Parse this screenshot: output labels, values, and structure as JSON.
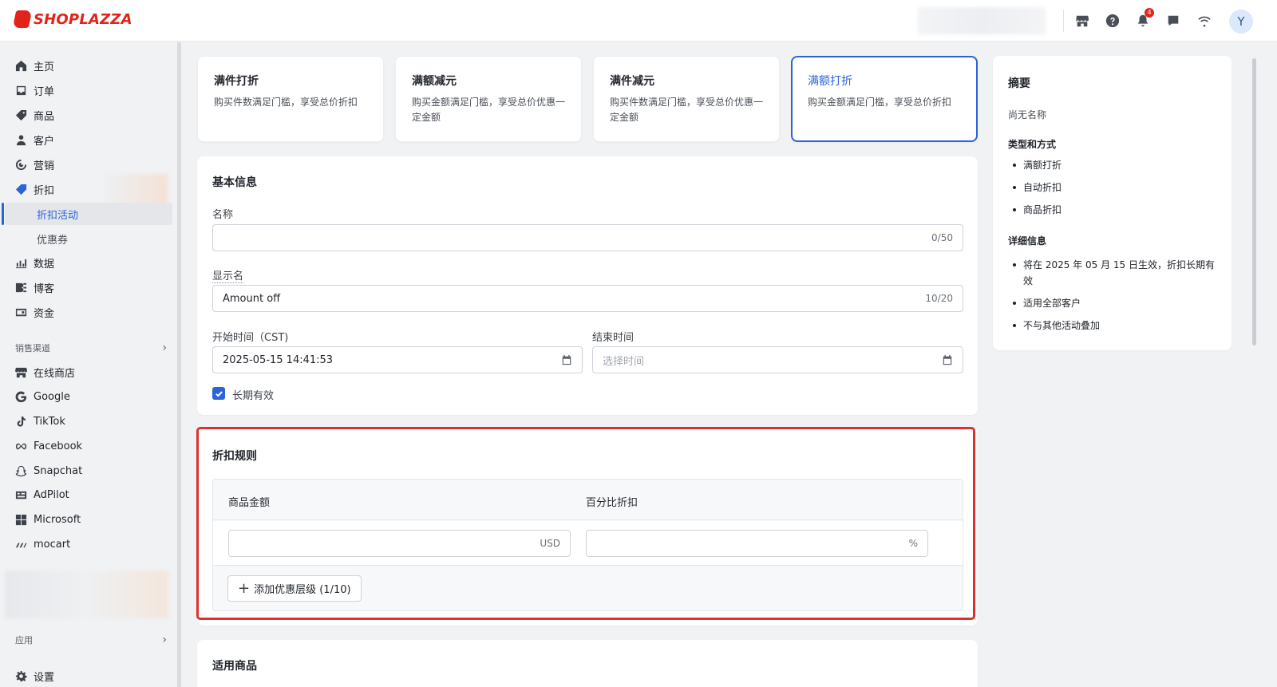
{
  "brand": {
    "name": "SHOPLAZZA",
    "color": "#e2231a"
  },
  "accent_color": "#2b63d9",
  "header": {
    "notifications_count": "4",
    "avatar_initial": "Y",
    "icons": [
      "store-icon",
      "help-icon",
      "bell-icon",
      "chat-icon",
      "wifi-icon"
    ]
  },
  "sidebar": {
    "items": [
      {
        "label": "主页",
        "icon": "home-icon"
      },
      {
        "label": "订单",
        "icon": "orders-icon"
      },
      {
        "label": "商品",
        "icon": "tag-icon"
      },
      {
        "label": "客户",
        "icon": "person-icon"
      },
      {
        "label": "营销",
        "icon": "marketing-icon"
      },
      {
        "label": "折扣",
        "icon": "discount-icon"
      }
    ],
    "discount_sub": [
      {
        "label": "折扣活动",
        "active": true
      },
      {
        "label": "优惠券",
        "active": false
      }
    ],
    "items_after": [
      {
        "label": "数据",
        "icon": "chart-icon"
      },
      {
        "label": "博客",
        "icon": "blog-icon"
      },
      {
        "label": "资金",
        "icon": "finance-icon"
      }
    ],
    "channels_label": "销售渠道",
    "channels": [
      {
        "label": "在线商店",
        "icon": "store-icon"
      },
      {
        "label": "Google",
        "icon": "google-icon"
      },
      {
        "label": "TikTok",
        "icon": "tiktok-icon"
      },
      {
        "label": "Facebook",
        "icon": "meta-icon"
      },
      {
        "label": "Snapchat",
        "icon": "snapchat-icon"
      },
      {
        "label": "AdPilot",
        "icon": "adpilot-icon"
      },
      {
        "label": "Microsoft",
        "icon": "microsoft-icon"
      },
      {
        "label": "mocart",
        "icon": "mocart-icon"
      }
    ],
    "apps_label": "应用",
    "settings_label": "设置"
  },
  "discount_types": [
    {
      "title": "满件打折",
      "desc": "购买件数满足门槛，享受总价折扣",
      "selected": false
    },
    {
      "title": "满额减元",
      "desc": "购买金额满足门槛，享受总价优惠一定金额",
      "selected": false
    },
    {
      "title": "满件减元",
      "desc": "购买件数满足门槛，享受总价优惠一定金额",
      "selected": false
    },
    {
      "title": "满额打折",
      "desc": "购买金额满足门槛，享受总价折扣",
      "selected": true
    }
  ],
  "basic_info": {
    "title": "基本信息",
    "name_label": "名称",
    "name_value": "",
    "name_counter": "0/50",
    "display_label": "显示名",
    "display_value": "Amount off",
    "display_counter": "10/20",
    "start_label": "开始时间（CST)",
    "start_value": "2025-05-15 14:41:53",
    "end_label": "结束时间",
    "end_placeholder": "选择时间",
    "long_term_label": "长期有效",
    "long_term_checked": true
  },
  "rules": {
    "title": "折扣规则",
    "col_amount": "商品金额",
    "col_percent": "百分比折扣",
    "amount_suffix": "USD",
    "percent_suffix": "%",
    "add_tier_label": "添加优惠层级 (1/10)"
  },
  "applicable": {
    "title": "适用商品"
  },
  "summary": {
    "title": "摘要",
    "no_name": "尚无名称",
    "type_heading": "类型和方式",
    "type_items": [
      "满额打折",
      "自动折扣",
      "商品折扣"
    ],
    "detail_heading": "详细信息",
    "detail_items": [
      "将在 2025 年 05 月 15 日生效，折扣长期有效",
      "适用全部客户",
      "不与其他活动叠加"
    ]
  }
}
